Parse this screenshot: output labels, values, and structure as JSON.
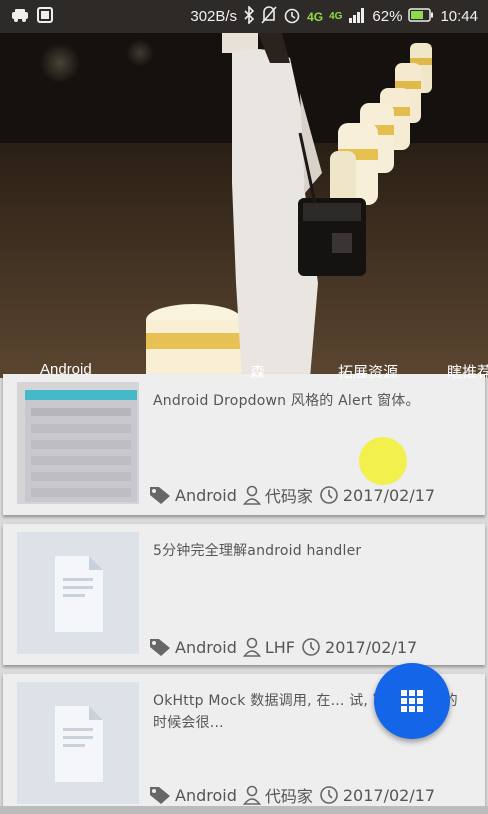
{
  "status_bar": {
    "speed": "302B/s",
    "network_1": "4G",
    "network_2": "4G",
    "battery": "62%",
    "time": "10:44",
    "icons": [
      "car-icon",
      "photo-icon",
      "bluetooth-icon",
      "mute-icon",
      "alarm-icon",
      "signal-icon",
      "battery-icon"
    ]
  },
  "hero": {
    "tabs": [
      "Android",
      "森",
      "拓展资源",
      "瞎推荐"
    ]
  },
  "articles": [
    {
      "title": "Android Dropdown 风格的 Alert 窗体。",
      "tag": "Android",
      "author": "代码家",
      "date": "2017/02/17"
    },
    {
      "title": "5分钟完全理解android handler",
      "tag": "Android",
      "author": "LHF",
      "date": "2017/02/17"
    },
    {
      "title": "OkHttp Mock 数据调用, 在... 试, 写测试用例的时候会很...",
      "tag": "Android",
      "author": "代码家",
      "date": "2017/02/17"
    }
  ],
  "fab": {
    "icon": "grid-icon"
  },
  "colors": {
    "fab": "#1565e8",
    "card": "#eeeeee",
    "text": "#555555",
    "touch": "#f2ef3a"
  }
}
